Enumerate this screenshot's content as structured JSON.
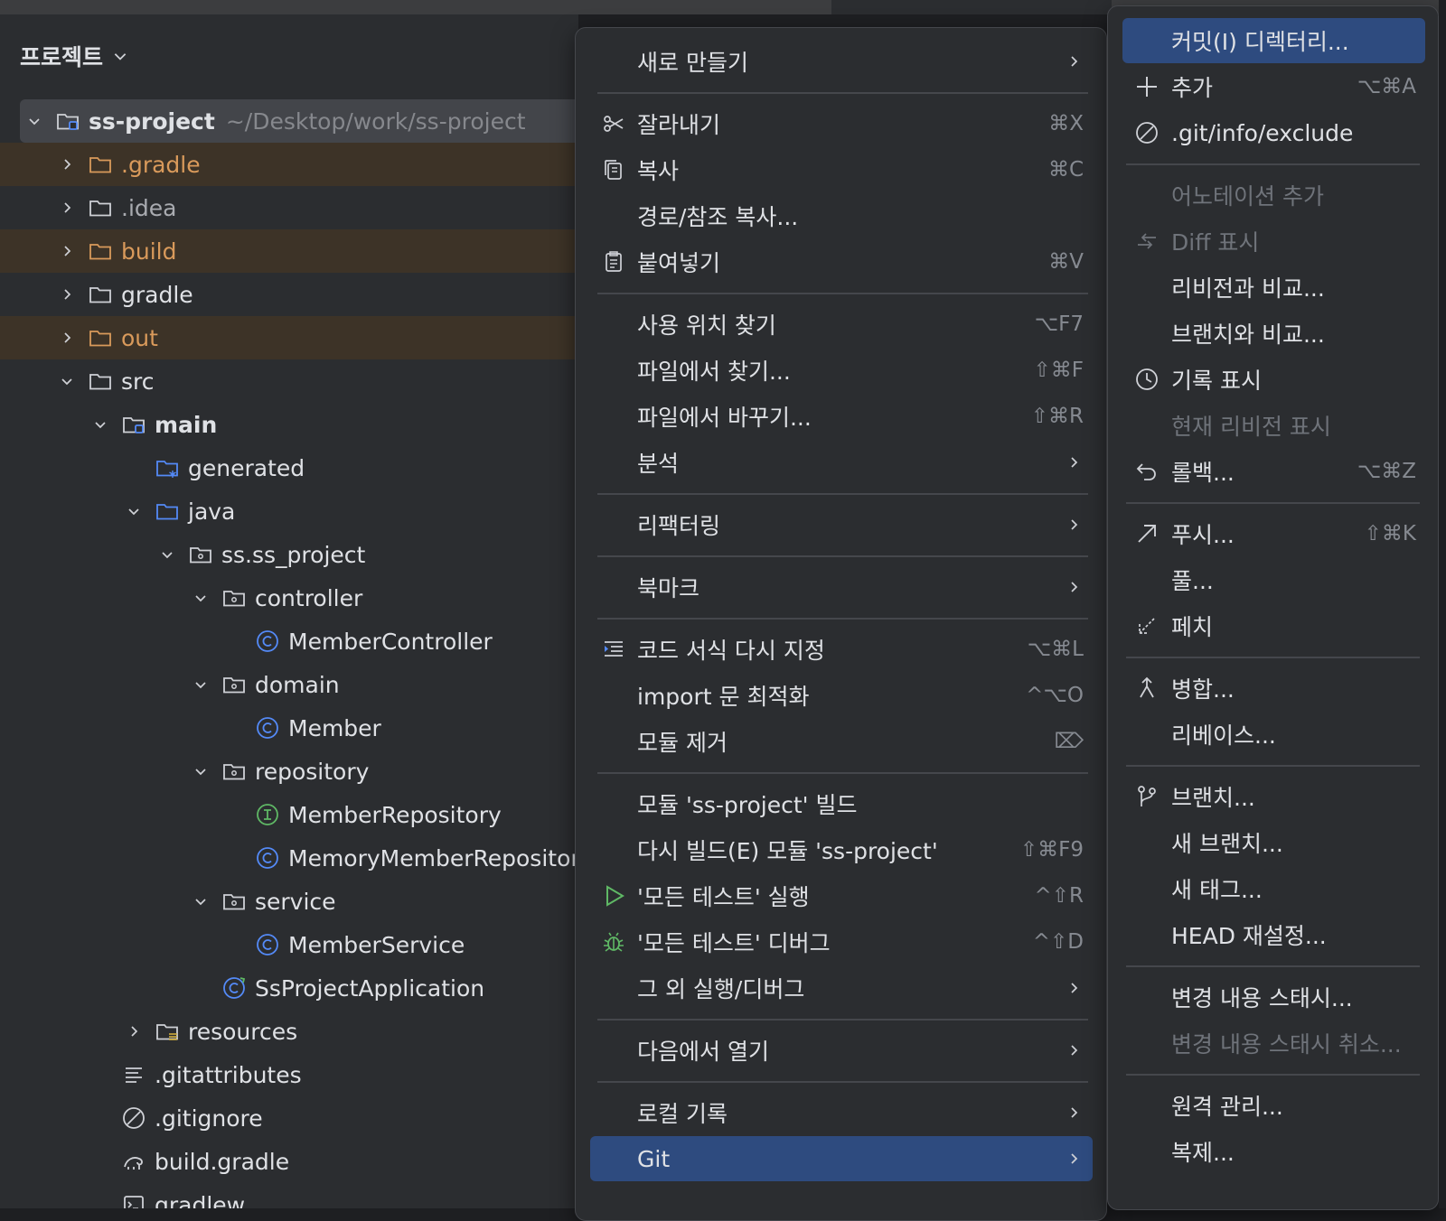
{
  "colors": {
    "selection": "#2e4b7f",
    "excluded": "#d99a5b",
    "panel": "#2b2d30"
  },
  "project": {
    "header": "프로젝트",
    "tree": [
      {
        "label": "ss-project",
        "sub": "~/Desktop/work/ss-project",
        "icon": "module-folder-icon",
        "depth": 0,
        "arrow": "down",
        "style": "root bold"
      },
      {
        "label": ".gradle",
        "icon": "excluded-folder-icon",
        "depth": 1,
        "arrow": "right",
        "style": "excl"
      },
      {
        "label": ".idea",
        "icon": "folder-icon",
        "depth": 1,
        "arrow": "right",
        "style": "dim"
      },
      {
        "label": "build",
        "icon": "excluded-folder-icon",
        "depth": 1,
        "arrow": "right",
        "style": "excl"
      },
      {
        "label": "gradle",
        "icon": "folder-icon",
        "depth": 1,
        "arrow": "right",
        "style": ""
      },
      {
        "label": "out",
        "icon": "excluded-folder-icon",
        "depth": 1,
        "arrow": "right",
        "style": "excl"
      },
      {
        "label": "src",
        "icon": "folder-icon",
        "depth": 1,
        "arrow": "down",
        "style": ""
      },
      {
        "label": "main",
        "icon": "module-folder-icon",
        "depth": 2,
        "arrow": "down",
        "style": "bold"
      },
      {
        "label": "generated",
        "icon": "generated-folder-icon",
        "depth": 3,
        "arrow": "",
        "style": ""
      },
      {
        "label": "java",
        "icon": "source-folder-icon",
        "depth": 3,
        "arrow": "down",
        "style": ""
      },
      {
        "label": "ss.ss_project",
        "icon": "package-icon",
        "depth": 4,
        "arrow": "down",
        "style": ""
      },
      {
        "label": "controller",
        "icon": "package-icon",
        "depth": 5,
        "arrow": "down",
        "style": ""
      },
      {
        "label": "MemberController",
        "icon": "class-icon",
        "depth": 6,
        "arrow": "",
        "style": ""
      },
      {
        "label": "domain",
        "icon": "package-icon",
        "depth": 5,
        "arrow": "down",
        "style": ""
      },
      {
        "label": "Member",
        "icon": "class-icon",
        "depth": 6,
        "arrow": "",
        "style": ""
      },
      {
        "label": "repository",
        "icon": "package-icon",
        "depth": 5,
        "arrow": "down",
        "style": ""
      },
      {
        "label": "MemberRepository",
        "icon": "interface-icon",
        "depth": 6,
        "arrow": "",
        "style": ""
      },
      {
        "label": "MemoryMemberRepository",
        "icon": "class-icon",
        "depth": 6,
        "arrow": "",
        "style": ""
      },
      {
        "label": "service",
        "icon": "package-icon",
        "depth": 5,
        "arrow": "down",
        "style": ""
      },
      {
        "label": "MemberService",
        "icon": "class-icon",
        "depth": 6,
        "arrow": "",
        "style": ""
      },
      {
        "label": "SsProjectApplication",
        "icon": "spring-class-icon",
        "depth": 5,
        "arrow": "",
        "style": ""
      },
      {
        "label": "resources",
        "icon": "resources-folder-icon",
        "depth": 3,
        "arrow": "right",
        "style": ""
      },
      {
        "label": ".gitattributes",
        "icon": "text-file-icon",
        "depth": 2,
        "arrow": "",
        "style": ""
      },
      {
        "label": ".gitignore",
        "icon": "ignore-file-icon",
        "depth": 2,
        "arrow": "",
        "style": ""
      },
      {
        "label": "build.gradle",
        "icon": "gradle-icon",
        "depth": 2,
        "arrow": "",
        "style": ""
      },
      {
        "label": "gradlew",
        "icon": "shell-file-icon",
        "depth": 2,
        "arrow": "",
        "style": ""
      }
    ]
  },
  "menu": [
    {
      "label": "새로 만들기",
      "icon": "",
      "shortcut": "",
      "submenu": true
    },
    {
      "sep": true
    },
    {
      "label": "잘라내기",
      "icon": "scissors-icon",
      "shortcut": "⌘X"
    },
    {
      "label": "복사",
      "icon": "copy-icon",
      "shortcut": "⌘C"
    },
    {
      "label": "경로/참조 복사...",
      "icon": "",
      "shortcut": ""
    },
    {
      "label": "붙여넣기",
      "icon": "paste-icon",
      "shortcut": "⌘V"
    },
    {
      "sep": true
    },
    {
      "label": "사용 위치 찾기",
      "icon": "",
      "shortcut": "⌥F7"
    },
    {
      "label": "파일에서 찾기...",
      "icon": "",
      "shortcut": "⇧⌘F"
    },
    {
      "label": "파일에서 바꾸기...",
      "icon": "",
      "shortcut": "⇧⌘R"
    },
    {
      "label": "분석",
      "icon": "",
      "shortcut": "",
      "submenu": true
    },
    {
      "sep": true
    },
    {
      "label": "리팩터링",
      "icon": "",
      "shortcut": "",
      "submenu": true
    },
    {
      "sep": true
    },
    {
      "label": "북마크",
      "icon": "",
      "shortcut": "",
      "submenu": true
    },
    {
      "sep": true
    },
    {
      "label": "코드 서식 다시 지정",
      "icon": "reformat-icon",
      "shortcut": "⌥⌘L"
    },
    {
      "label": "import 문 최적화",
      "icon": "",
      "shortcut": "^⌥O"
    },
    {
      "label": "모듈 제거",
      "icon": "",
      "shortcut": "⌦"
    },
    {
      "sep": true
    },
    {
      "label": "모듈 'ss-project' 빌드",
      "icon": "",
      "shortcut": ""
    },
    {
      "label": "다시 빌드(E) 모듈 'ss-project'",
      "icon": "",
      "shortcut": "⇧⌘F9"
    },
    {
      "label": "'모든 테스트' 실행",
      "icon": "run-icon",
      "shortcut": "^⇧R"
    },
    {
      "label": "'모든 테스트' 디버그",
      "icon": "debug-icon",
      "shortcut": "^⇧D"
    },
    {
      "label": "그 외 실행/디버그",
      "icon": "",
      "shortcut": "",
      "submenu": true
    },
    {
      "sep": true
    },
    {
      "label": "다음에서 열기",
      "icon": "",
      "shortcut": "",
      "submenu": true
    },
    {
      "sep": true
    },
    {
      "label": "로컬 기록",
      "icon": "",
      "shortcut": "",
      "submenu": true
    },
    {
      "label": "Git",
      "icon": "",
      "shortcut": "",
      "submenu": true,
      "selected": true
    }
  ],
  "git_menu": [
    {
      "label": "커밋(I) 디렉터리...",
      "icon": "",
      "shortcut": "",
      "selected": true
    },
    {
      "label": "추가",
      "icon": "plus-icon",
      "shortcut": "⌥⌘A"
    },
    {
      "label": ".git/info/exclude",
      "icon": "ignore-icon",
      "shortcut": ""
    },
    {
      "sep": true
    },
    {
      "label": "어노테이션 추가",
      "icon": "",
      "shortcut": "",
      "disabled": true
    },
    {
      "label": "Diff 표시",
      "icon": "diff-icon",
      "shortcut": "",
      "disabled": true
    },
    {
      "label": "리비전과 비교...",
      "icon": "",
      "shortcut": ""
    },
    {
      "label": "브랜치와 비교...",
      "icon": "",
      "shortcut": ""
    },
    {
      "label": "기록 표시",
      "icon": "history-icon",
      "shortcut": ""
    },
    {
      "label": "현재 리비전 표시",
      "icon": "",
      "shortcut": "",
      "disabled": true
    },
    {
      "label": "롤백...",
      "icon": "rollback-icon",
      "shortcut": "⌥⌘Z"
    },
    {
      "sep": true
    },
    {
      "label": "푸시...",
      "icon": "push-icon",
      "shortcut": "⇧⌘K"
    },
    {
      "label": "풀...",
      "icon": "",
      "shortcut": ""
    },
    {
      "label": "페치",
      "icon": "fetch-icon",
      "shortcut": ""
    },
    {
      "sep": true
    },
    {
      "label": "병합...",
      "icon": "merge-icon",
      "shortcut": ""
    },
    {
      "label": "리베이스...",
      "icon": "",
      "shortcut": ""
    },
    {
      "sep": true
    },
    {
      "label": "브랜치...",
      "icon": "branch-icon",
      "shortcut": ""
    },
    {
      "label": "새 브랜치...",
      "icon": "",
      "shortcut": ""
    },
    {
      "label": "새 태그...",
      "icon": "",
      "shortcut": ""
    },
    {
      "label": "HEAD 재설정...",
      "icon": "",
      "shortcut": ""
    },
    {
      "sep": true
    },
    {
      "label": "변경 내용 스태시...",
      "icon": "",
      "shortcut": ""
    },
    {
      "label": "변경 내용 스태시 취소...",
      "icon": "",
      "shortcut": "",
      "disabled": true
    },
    {
      "sep": true
    },
    {
      "label": "원격 관리...",
      "icon": "",
      "shortcut": ""
    },
    {
      "label": "복제...",
      "icon": "",
      "shortcut": ""
    }
  ]
}
